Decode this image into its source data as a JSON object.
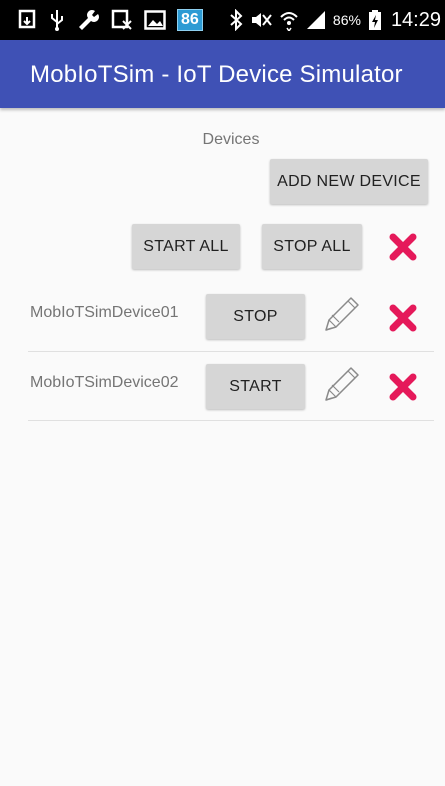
{
  "status_bar": {
    "notification_badge": "86",
    "battery_percent": "86%",
    "time": "14:29",
    "icons": [
      "download-icon",
      "usb-icon",
      "wrench-icon",
      "sim-off-icon",
      "image-icon",
      "bluetooth-icon",
      "mute-icon",
      "wifi-icon",
      "signal-icon",
      "battery-charging-icon"
    ]
  },
  "app_bar": {
    "title": "MobIoTSim - IoT Device Simulator",
    "color": "#3f51b5"
  },
  "devices_section": {
    "title": "Devices",
    "add_button": "ADD NEW DEVICE",
    "start_all": "START ALL",
    "stop_all": "STOP ALL"
  },
  "devices": [
    {
      "name": "MobIoTSimDevice01",
      "action": "STOP"
    },
    {
      "name": "MobIoTSimDevice02",
      "action": "START"
    }
  ],
  "colors": {
    "delete": "#e5195a",
    "button": "#d6d6d6"
  }
}
